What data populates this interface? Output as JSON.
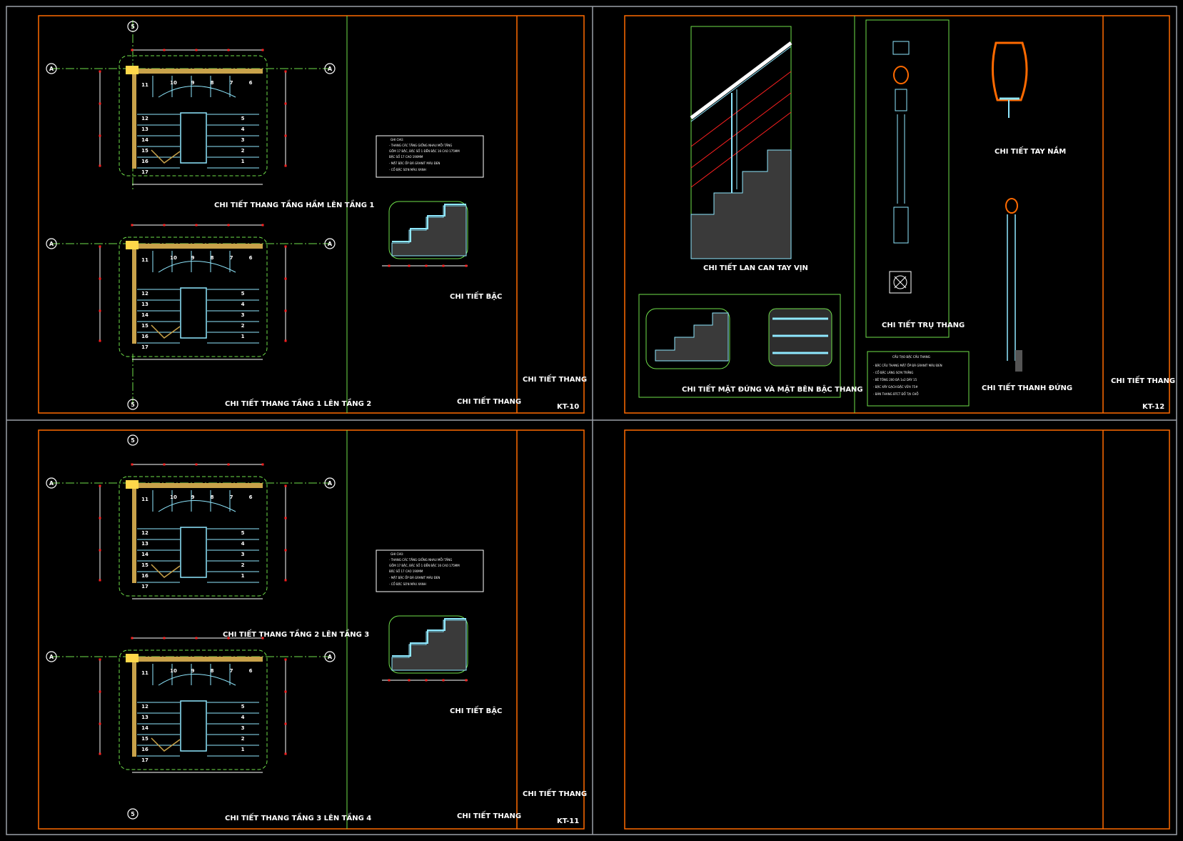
{
  "sheets": [
    {
      "id": "kt-10",
      "sheet_no": "KT-10",
      "title_block": "CHI TIẾT THANG",
      "drawing_title": "CHI TIẾT THANG",
      "plans": [
        {
          "caption": "CHI TIẾT THANG TẦNG HẦM LÊN TẦNG 1"
        },
        {
          "caption": "CHI TIẾT THANG TẦNG 1 LÊN TẦNG 2"
        }
      ],
      "step_detail_caption": "CHI TIẾT BẬC",
      "notes_heading": "GHI CHÚ:",
      "notes": [
        "- THANG CÁC TẦNG GIỐNG NHAU MỖI TẦNG",
        "  GỒM 17 BẬC, BẬC SỐ 1 ĐẾN BẬC 16 CAO 175MM",
        "  BẬC SỐ 17 CAO 190MM",
        "- MẶT BẬC ỐP ĐÁ GRANIT MÀU ĐEN",
        "- CỔ BẬC SƠN MÀU XANH"
      ]
    },
    {
      "id": "kt-11",
      "sheet_no": "KT-11",
      "title_block": "CHI TIẾT THANG",
      "drawing_title": "CHI TIẾT THANG",
      "plans": [
        {
          "caption": "CHI TIẾT THANG TẦNG 2 LÊN TẦNG 3"
        },
        {
          "caption": "CHI TIẾT THANG TẦNG 3 LÊN TẦNG 4"
        }
      ],
      "step_detail_caption": "CHI TIẾT BẬC",
      "notes_heading": "GHI CHÚ:",
      "notes": [
        "- THANG CÁC TẦNG GIỐNG NHAU MỖI TẦNG",
        "  GỒM 17 BẬC, BẬC SỐ 1 ĐẾN BẬC 16 CAO 175MM",
        "  BẬC SỐ 17 CAO 190MM",
        "- MẶT BẬC ỐP ĐÁ GRANIT MÀU ĐEN",
        "- CỔ BẬC SƠN MÀU XANH"
      ]
    },
    {
      "id": "kt-12",
      "sheet_no": "KT-12",
      "title_block": "CHI TIẾT THANG",
      "details": {
        "railing": "CHI TIẾT LAN CAN TAY VỊN",
        "post": "CHI TIẾT TRỤ THANG",
        "handrail": "CHI TIẾT TAY NẮM",
        "baluster": "CHI TIẾT THANH ĐỨNG",
        "elevation": "CHI TIẾT MẶT ĐỨNG VÀ MẶT BÊN BẬC THANG"
      },
      "structure_heading": "CẤU TẠO BẬC CẦU THANG",
      "structure_notes": [
        "- BẬC CẦU THANG MẶT ỐP ĐÁ GRANIT MÀU ĐEN",
        "- CỔ BẬC LÁNG SƠN TRẮNG",
        "- BÊ TÔNG 200 ĐÁ 1x2 DÀY 15",
        "- BẬC XÂY GẠCH ĐẶC VỮA 75#",
        "- BẢN THANG BTCT ĐỔ TẠI CHỖ"
      ]
    }
  ],
  "plan_labels": {
    "left_numbers": [
      "11",
      "12",
      "13",
      "14",
      "15",
      "16",
      "17"
    ],
    "top_numbers": [
      "10",
      "9",
      "8",
      "7",
      "6"
    ],
    "right_numbers": [
      "5",
      "4",
      "3",
      "2",
      "1"
    ],
    "axis_a": "A",
    "axis_5": "5"
  },
  "colors": {
    "frame": "#ff6a00",
    "green": "#6fe04a",
    "cyan": "#8fe8ff",
    "red": "#ff2020",
    "wall": "#c8a24a",
    "yellow": "#ffd84a",
    "white": "#ffffff",
    "background": "#000000",
    "grid": "#9aa0a8"
  }
}
